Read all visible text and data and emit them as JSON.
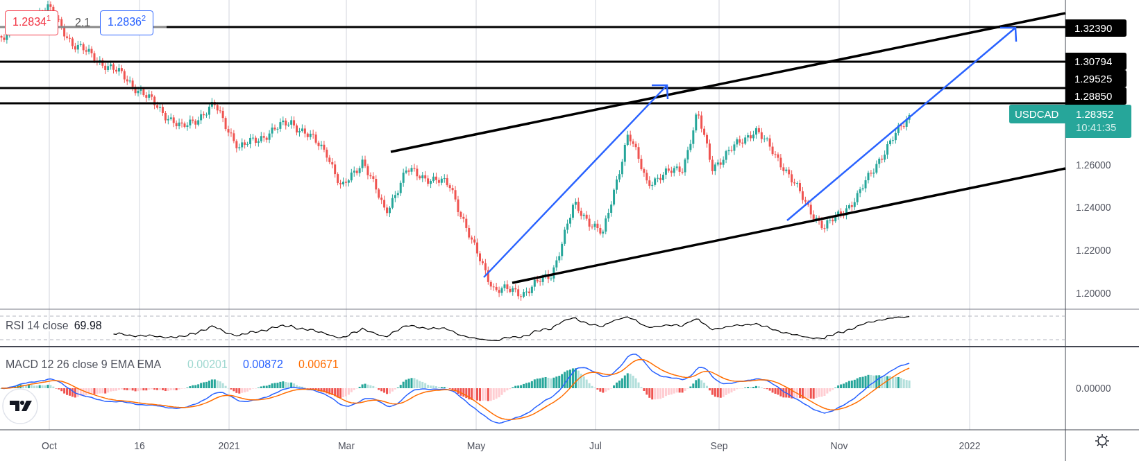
{
  "measure": {
    "start_label": "1.2834$^{1}$",
    "delta": "2.1",
    "end_label": "1.2836$^{2}$"
  },
  "levels": [
    {
      "label": "1.32390"
    },
    {
      "label": "1.30794"
    },
    {
      "label": "1.29525"
    },
    {
      "label": "1.28850"
    }
  ],
  "last_price": {
    "symbol": "USDCAD",
    "price": "1.28352",
    "countdown": "10:41:35"
  },
  "price_axis": {
    "labels": [
      "1.26000",
      "1.24000",
      "1.22000",
      "1.20000"
    ]
  },
  "rsi": {
    "title": "RSI 14 close",
    "value": "69.98"
  },
  "macd": {
    "title": "MACD 12 26 close 9 EMA EMA",
    "histogram": "0.00201",
    "macd": "0.00872",
    "signal": "0.00671",
    "axis_label": "0.00000"
  },
  "time_axis": {
    "labels": [
      "Oct",
      "16",
      "2021",
      "Mar",
      "May",
      "Jul",
      "Sep",
      "Nov",
      "2022"
    ]
  }
}
